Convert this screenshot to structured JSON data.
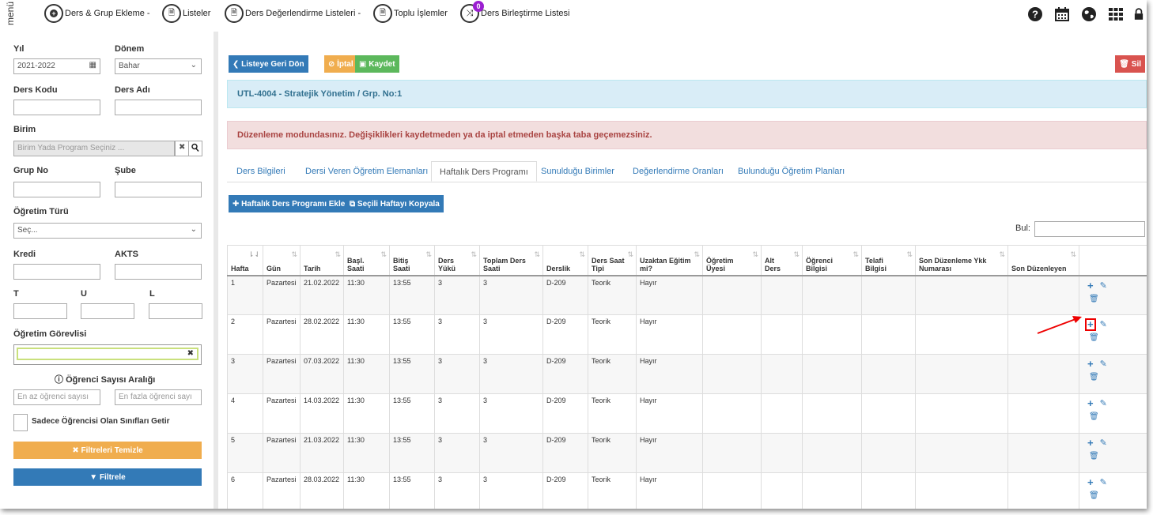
{
  "topnav": {
    "menu_label": "menü",
    "items": [
      {
        "label": "Ders & Grup Ekleme -"
      },
      {
        "label": "Listeler"
      },
      {
        "label": "Ders Değerlendirme Listeleri -"
      },
      {
        "label": "Toplu İşlemler"
      },
      {
        "label": "Ders Birleştirme Listesi",
        "badge": "0"
      }
    ]
  },
  "filters": {
    "yil_label": "Yıl",
    "yil_value": "2021-2022",
    "donem_label": "Dönem",
    "donem_value": "Bahar",
    "ders_kodu_label": "Ders Kodu",
    "ders_adi_label": "Ders Adı",
    "birim_label": "Birim",
    "birim_placeholder": "Birim Yada Program Seçiniz ...",
    "grup_no_label": "Grup No",
    "sube_label": "Şube",
    "ogretim_turu_label": "Öğretim Türü",
    "ogretim_turu_value": "Seç...",
    "kredi_label": "Kredi",
    "akts_label": "AKTS",
    "t_label": "T",
    "u_label": "U",
    "l_label": "L",
    "ogretim_gorevlisi_label": "Öğretim Görevlisi",
    "ogrenci_araligi_label": "Öğrenci Sayısı Aralığı",
    "min_placeholder": "En az öğrenci sayısı",
    "max_placeholder": "En fazla öğrenci sayı",
    "sadece_label": "Sadece Öğrencisi Olan Sınıfları Getir",
    "temizle_label": "✖ Filtreleri Temizle",
    "filtrele_label": "▼ Filtrele"
  },
  "toolbar": {
    "back_label": "❮ Listeye Geri Dön",
    "cancel_label": "⊘ İptal",
    "save_label": "▣ Kaydet",
    "delete_label": "🗑 Sil"
  },
  "info_text": "UTL-4004 - Stratejik Yönetim / Grp. No:1",
  "warning_text": "Düzenleme modundasınız. Değişiklikleri kaydetmeden ya da iptal etmeden başka taba geçemezsiniz.",
  "tabs": [
    {
      "label": "Ders Bilgileri"
    },
    {
      "label": "Dersi Veren Öğretim Elemanları"
    },
    {
      "label": "Haftalık Ders Programı"
    },
    {
      "label": "Sunulduğu Birimler"
    },
    {
      "label": "Değerlendirme Oranları"
    },
    {
      "label": "Bulunduğu Öğretim Planları"
    }
  ],
  "actions": {
    "add_label": "✚ Haftalık Ders Programı Ekle",
    "copy_label": "⧉ Seçili Haftayı Kopyala",
    "search_label": "Bul:"
  },
  "table": {
    "headers": [
      "Hafta",
      "Gün",
      "Tarih",
      "Başl. Saati",
      "Bitiş Saati",
      "Ders Yükü",
      "Toplam Ders Saati",
      "Derslik",
      "Ders Saat Tipi",
      "Uzaktan Eğitim mi?",
      "Öğretim Üyesi",
      "Alt Ders",
      "Öğrenci Bilgisi",
      "Telafi Bilgisi",
      "Son Düzenleme Ykk Numarası",
      "Son Düzenleyen",
      ""
    ],
    "rows": [
      [
        "1",
        "Pazartesi",
        "21.02.2022",
        "11:30",
        "13:55",
        "3",
        "3",
        "D-209",
        "Teorik",
        "Hayır",
        "",
        "",
        "",
        "",
        "",
        ""
      ],
      [
        "2",
        "Pazartesi",
        "28.02.2022",
        "11:30",
        "13:55",
        "3",
        "3",
        "D-209",
        "Teorik",
        "Hayır",
        "",
        "",
        "",
        "",
        "",
        ""
      ],
      [
        "3",
        "Pazartesi",
        "07.03.2022",
        "11:30",
        "13:55",
        "3",
        "3",
        "D-209",
        "Teorik",
        "Hayır",
        "",
        "",
        "",
        "",
        "",
        ""
      ],
      [
        "4",
        "Pazartesi",
        "14.03.2022",
        "11:30",
        "13:55",
        "3",
        "3",
        "D-209",
        "Teorik",
        "Hayır",
        "",
        "",
        "",
        "",
        "",
        ""
      ],
      [
        "5",
        "Pazartesi",
        "21.03.2022",
        "11:30",
        "13:55",
        "3",
        "3",
        "D-209",
        "Teorik",
        "Hayır",
        "",
        "",
        "",
        "",
        "",
        ""
      ],
      [
        "6",
        "Pazartesi",
        "28.03.2022",
        "11:30",
        "13:55",
        "3",
        "3",
        "D-209",
        "Teorik",
        "Hayır",
        "",
        "",
        "",
        "",
        "",
        ""
      ]
    ]
  },
  "colors": {
    "primary": "#337ab7",
    "warning": "#f0ad4e",
    "success": "#5cb85c",
    "danger": "#d9534f",
    "highlight": "#e00000"
  }
}
